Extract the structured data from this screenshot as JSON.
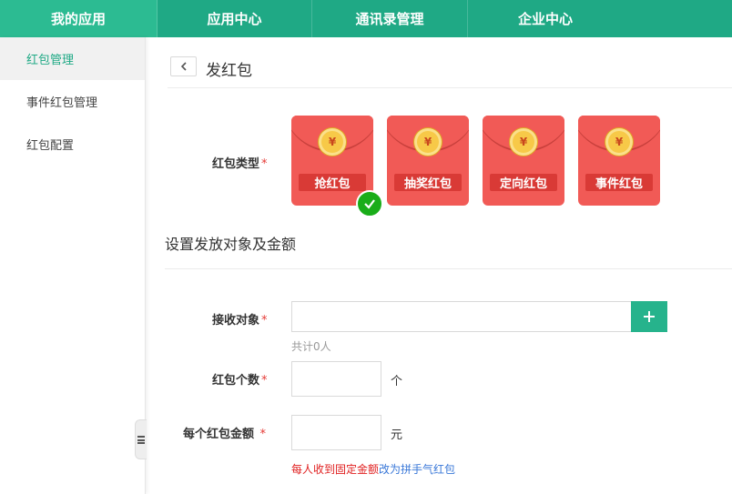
{
  "topnav": {
    "tabs": [
      {
        "label": "我的应用",
        "active": true
      },
      {
        "label": "应用中心",
        "active": false
      },
      {
        "label": "通讯录管理",
        "active": false
      },
      {
        "label": "企业中心",
        "active": false
      }
    ]
  },
  "sidebar": {
    "items": [
      {
        "label": "红包管理",
        "active": true
      },
      {
        "label": "事件红包管理",
        "active": false
      },
      {
        "label": "红包配置",
        "active": false
      }
    ]
  },
  "page": {
    "title": "发红包"
  },
  "form": {
    "packet_type_label": "红包类型",
    "required_mark": "*",
    "packet_types": [
      {
        "label": "抢红包",
        "selected": true
      },
      {
        "label": "抽奖红包",
        "selected": false
      },
      {
        "label": "定向红包",
        "selected": false
      },
      {
        "label": "事件红包",
        "selected": false
      }
    ],
    "coin_symbol": "¥",
    "section_title": "设置发放对象及金额",
    "recipient_label": "接收对象",
    "recipient_value": "",
    "recipient_count_hint": "共计0人",
    "count_label": "红包个数",
    "count_value": "",
    "count_unit": "个",
    "amount_label": "每个红包金额",
    "amount_value": "",
    "amount_unit": "元",
    "fixed_note": "每人收到固定金额",
    "switch_link": "改为拼手气红包"
  },
  "colors": {
    "nav_bg": "#1fa985",
    "nav_active": "#2cbb92",
    "packet_red": "#f15a56",
    "add_button": "#26b38c",
    "check_green": "#1aad19",
    "link_blue": "#3a78d8"
  },
  "icons": {
    "back": "chevron-left-icon",
    "add": "plus-icon",
    "selected": "check-icon",
    "collapse": "menu-collapse-icon"
  }
}
